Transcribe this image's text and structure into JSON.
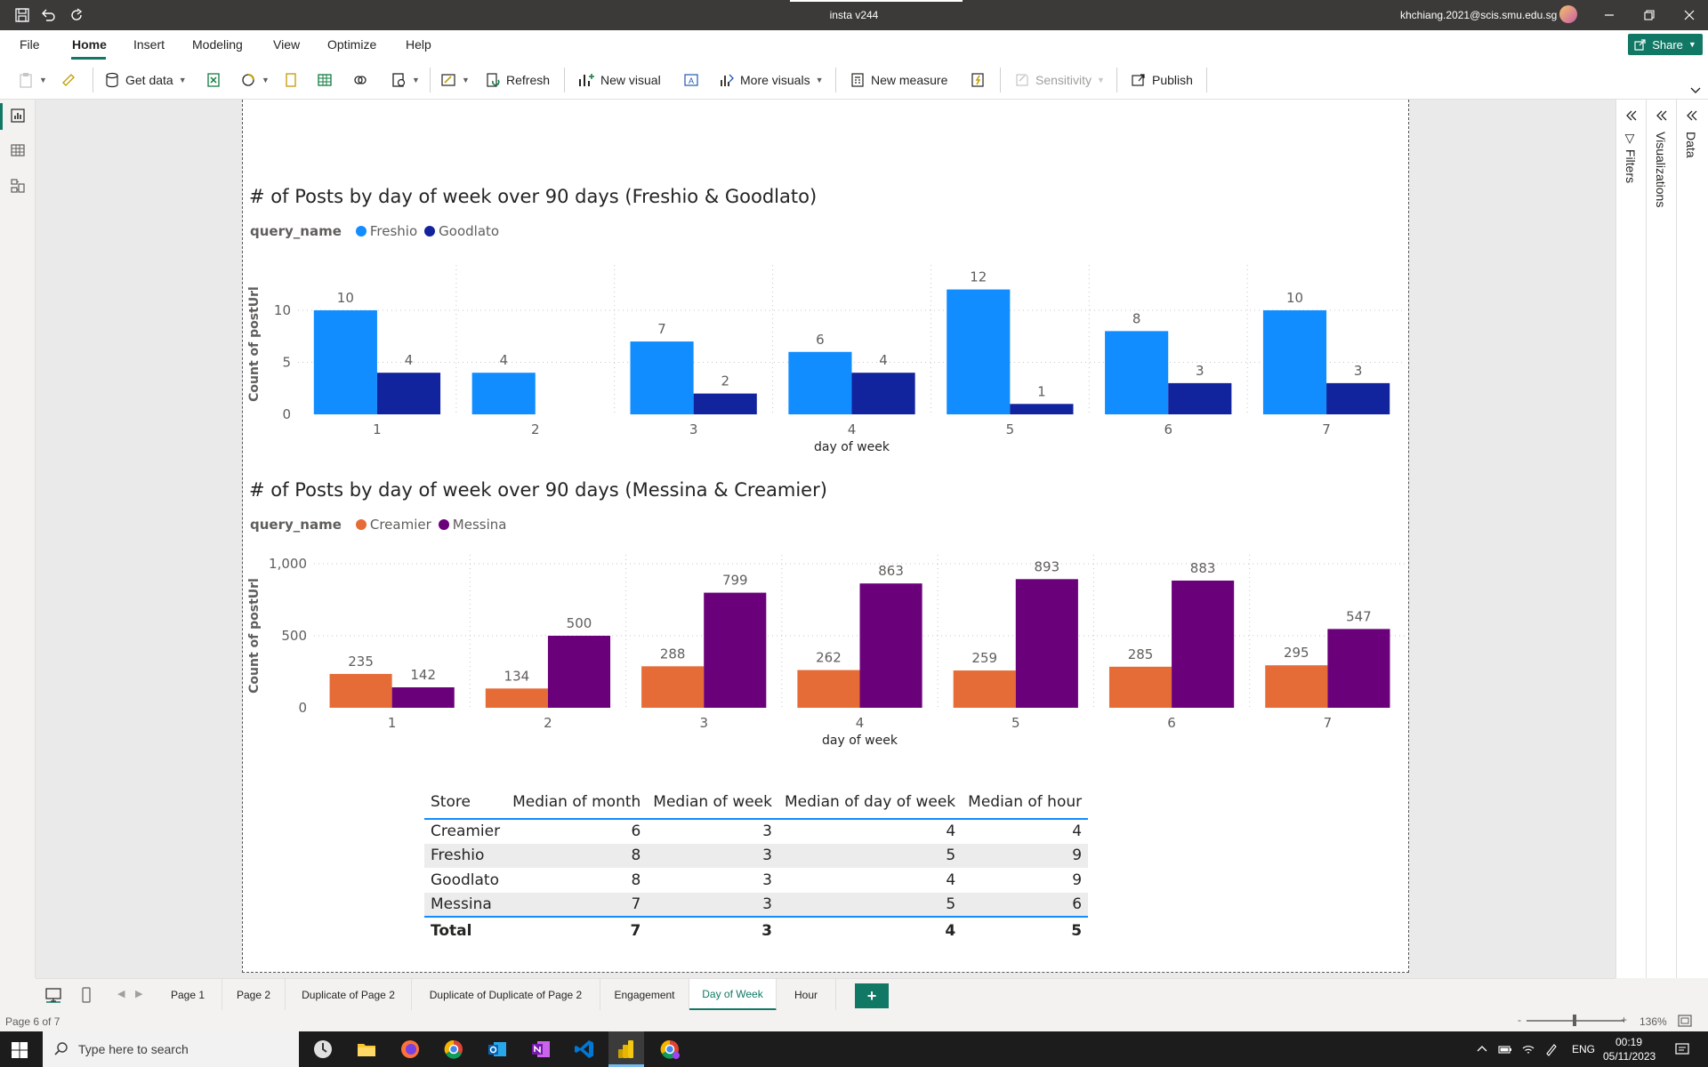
{
  "window": {
    "title": "insta v244",
    "user_email": "khchiang.2021@scis.smu.edu.sg"
  },
  "menu": {
    "file": "File",
    "home": "Home",
    "insert": "Insert",
    "modeling": "Modeling",
    "view": "View",
    "optimize": "Optimize",
    "help": "Help",
    "share": "Share"
  },
  "toolbar": {
    "get_data": "Get data",
    "refresh": "Refresh",
    "new_visual": "New visual",
    "more_visuals": "More visuals",
    "new_measure": "New measure",
    "sensitivity": "Sensitivity",
    "publish": "Publish"
  },
  "panes": {
    "filters": "Filters",
    "visualizations": "Visualizations",
    "data": "Data"
  },
  "chart_data": [
    {
      "type": "bar",
      "title": "# of Posts by day of week over 90 days (Freshio & Goodlato)",
      "legend_title": "query_name",
      "xlabel": "day of week",
      "ylabel": "Count of postUrl",
      "categories": [
        "1",
        "2",
        "3",
        "4",
        "5",
        "6",
        "7"
      ],
      "yticks": [
        "0",
        "5",
        "10"
      ],
      "ylim": [
        0,
        13.5
      ],
      "grid": true,
      "series": [
        {
          "name": "Freshio",
          "color": "#118dff",
          "values": [
            10,
            4,
            7,
            6,
            12,
            8,
            10
          ]
        },
        {
          "name": "Goodlato",
          "color": "#12239e",
          "values": [
            4,
            null,
            2,
            4,
            1,
            3,
            3
          ]
        }
      ]
    },
    {
      "type": "bar",
      "title": "# of Posts by day of week over 90 days (Messina & Creamier)",
      "legend_title": "query_name",
      "xlabel": "day of week",
      "ylabel": "Count of postUrl",
      "categories": [
        "1",
        "2",
        "3",
        "4",
        "5",
        "6",
        "7"
      ],
      "yticks": [
        "0",
        "500",
        "1,000"
      ],
      "ylim": [
        0,
        1000
      ],
      "grid": true,
      "series": [
        {
          "name": "Creamier",
          "color": "#e66c37",
          "values": [
            235,
            134,
            288,
            262,
            259,
            285,
            295
          ]
        },
        {
          "name": "Messina",
          "color": "#6b007b",
          "values": [
            142,
            500,
            799,
            863,
            893,
            883,
            547
          ]
        }
      ]
    }
  ],
  "table": {
    "headers": [
      "Store",
      "Median of month",
      "Median of week",
      "Median of day of week",
      "Median of hour"
    ],
    "rows": [
      [
        "Creamier",
        "6",
        "3",
        "4",
        "4"
      ],
      [
        "Freshio",
        "8",
        "3",
        "5",
        "9"
      ],
      [
        "Goodlato",
        "8",
        "3",
        "4",
        "9"
      ],
      [
        "Messina",
        "7",
        "3",
        "5",
        "6"
      ]
    ],
    "total": [
      "Total",
      "7",
      "3",
      "4",
      "5"
    ]
  },
  "pages": {
    "tabs": [
      "Page 1",
      "Page 2",
      "Duplicate of Page 2",
      "Duplicate of Duplicate of Page 2",
      "Engagement",
      "Day of Week",
      "Hour"
    ],
    "active": "Day of Week",
    "add": "+"
  },
  "status": {
    "page_indicator": "Page 6 of 7",
    "zoom_minus": "-",
    "zoom_plus": "+",
    "zoom": "136%"
  },
  "taskbar": {
    "search_placeholder": "Type here to search",
    "lang": "ENG",
    "time": "00:19",
    "date": "05/11/2023"
  }
}
